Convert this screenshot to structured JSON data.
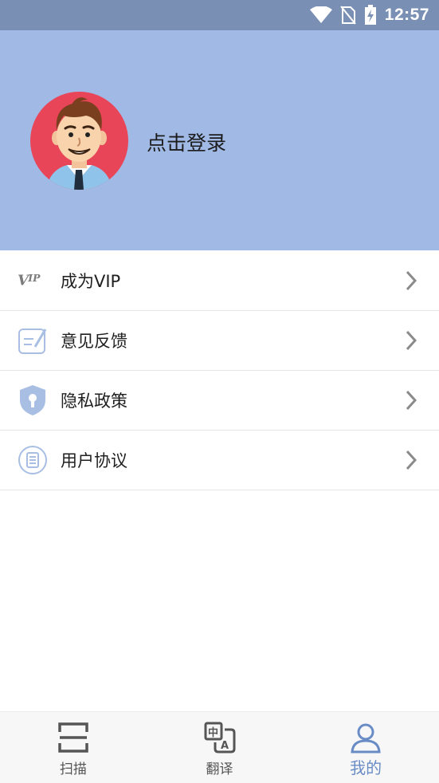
{
  "status_bar": {
    "time": "12:57",
    "icons": [
      "wifi-icon",
      "no-sim-icon",
      "battery-charging-icon"
    ]
  },
  "header": {
    "login_label": "点击登录",
    "background_color": "#a1b9e5",
    "avatar_bg_color": "#e94558"
  },
  "menu": {
    "items": [
      {
        "icon": "vip-icon",
        "label": "成为VIP"
      },
      {
        "icon": "feedback-icon",
        "label": "意见反馈"
      },
      {
        "icon": "shield-lock-icon",
        "label": "隐私政策"
      },
      {
        "icon": "document-icon",
        "label": "用户协议"
      }
    ]
  },
  "bottom_nav": {
    "tabs": [
      {
        "icon": "scan-icon",
        "label": "扫描",
        "active": false
      },
      {
        "icon": "translate-icon",
        "label": "翻译",
        "active": false
      },
      {
        "icon": "user-icon",
        "label": "我的",
        "active": true
      }
    ],
    "active_color": "#6a8cc6"
  }
}
